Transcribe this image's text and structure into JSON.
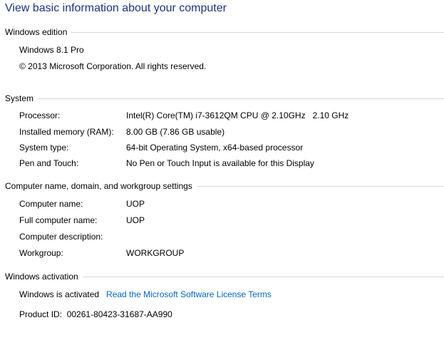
{
  "page_title": "View basic information about your computer",
  "windows_edition": {
    "header": "Windows edition",
    "edition": "Windows 8.1 Pro",
    "copyright": "© 2013 Microsoft Corporation. All rights reserved."
  },
  "system": {
    "header": "System",
    "rows": [
      {
        "label": "Processor:",
        "value": "Intel(R) Core(TM) i7-3612QM CPU @ 2.10GHz   2.10 GHz"
      },
      {
        "label": "Installed memory (RAM):",
        "value": "8.00 GB (7.86 GB usable)"
      },
      {
        "label": "System type:",
        "value": "64-bit Operating System, x64-based processor"
      },
      {
        "label": "Pen and Touch:",
        "value": "No Pen or Touch Input is available for this Display"
      }
    ]
  },
  "computer_name": {
    "header": "Computer name, domain, and workgroup settings",
    "rows": [
      {
        "label": "Computer name:",
        "value": "UOP"
      },
      {
        "label": "Full computer name:",
        "value": "UOP"
      },
      {
        "label": "Computer description:",
        "value": ""
      },
      {
        "label": "Workgroup:",
        "value": "WORKGROUP"
      }
    ]
  },
  "activation": {
    "header": "Windows activation",
    "status": "Windows is activated",
    "license_link": "Read the Microsoft Software License Terms",
    "product_id_label": "Product ID:",
    "product_id": "00261-80423-31687-AA990"
  },
  "colors": {
    "title": "#1e3287",
    "link": "#0066cc",
    "rule": "#d8d8d8"
  }
}
